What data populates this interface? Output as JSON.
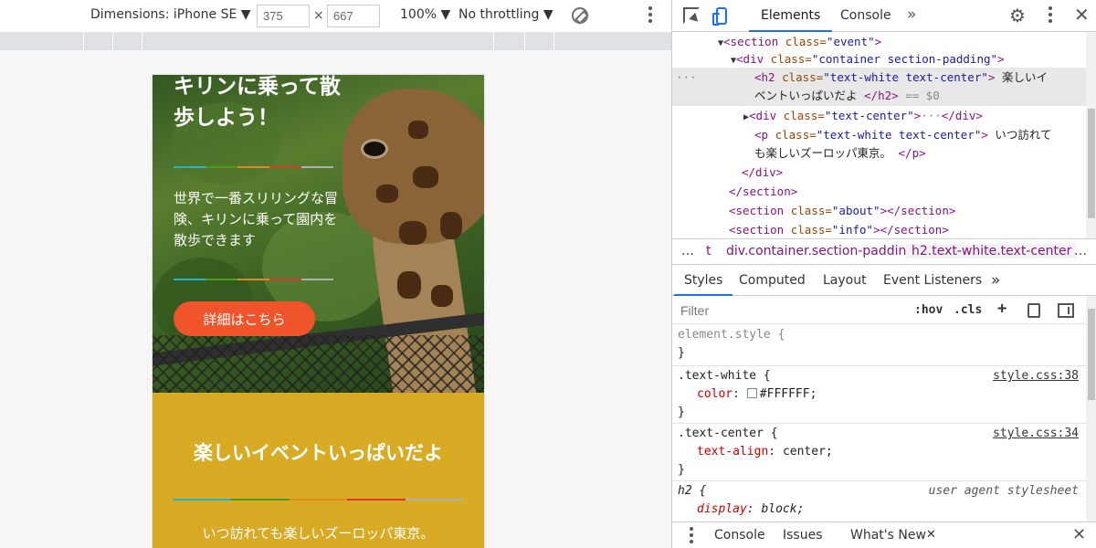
{
  "device_toolbar": {
    "dimensions": "Dimensions: iPhone SE",
    "width": "375",
    "height": "667",
    "times": "×",
    "zoom": "100%",
    "throttling": "No throttling"
  },
  "page": {
    "hero_title": "キリンに乗って散歩しよう！",
    "hero_text": "世界で一番スリリングな冒険、キリンに乗って園内を散歩できます",
    "cta_label": "詳細はこちら",
    "event_title": "楽しいイベントいっぱいだよ",
    "event_text": "いつ訪れても楽しいズーロッパ東京。",
    "stripe_colors": [
      "#1fb6c9",
      "#4e9a1e",
      "#e0891f",
      "#d9392b",
      "#b0b0b0"
    ],
    "button_color": "#f0542b",
    "event_bg": "#d9ab25"
  },
  "devtools": {
    "tabs": [
      "Elements",
      "Console"
    ],
    "active_tab": "Elements",
    "more": "»",
    "dom": {
      "l1_tag": "<section",
      "l1_attr": " class=",
      "l1_val": "\"event\"",
      "l1_end": ">",
      "l2_tag": "<div",
      "l2_attr": " class=",
      "l2_val": "\"container section-padding\"",
      "l2_end": ">",
      "sel_tag": "<h2",
      "sel_attr": " class=",
      "sel_val": "\"text-white text-center\"",
      "sel_end": ">",
      "sel_text1": " 楽しいイ",
      "sel_text2": "ベントいっぱいだよ ",
      "sel_close": "</h2>",
      "sel_eq": " == $0",
      "ellipsis": "···",
      "l4_tag": "<div",
      "l4_attr": " class=",
      "l4_val": "\"text-center\"",
      "l4_end": ">",
      "l4_dots": "···",
      "l4_close": "</div>",
      "l5_tag": "<p",
      "l5_attr": " class=",
      "l5_val": "\"text-white text-center\"",
      "l5_end": ">",
      "l5_text1": " いつ訪れて",
      "l5_text2": "も楽しいズーロッパ東京。 ",
      "l5_close": "</p>",
      "l6": "</div>",
      "l7": "</section>",
      "l8_tag": "<section",
      "l8_attr": " class=",
      "l8_val": "\"about\"",
      "l8_end": "></section>",
      "l9_tag": "<section",
      "l9_attr": " class=",
      "l9_val": "\"info\"",
      "l9_end": "></section>"
    },
    "breadcrumb": [
      "…",
      "t",
      "div.container.section-padding",
      "h2.text-white.text-center",
      "…"
    ],
    "style_tabs": [
      "Styles",
      "Computed",
      "Layout",
      "Event Listeners"
    ],
    "styles_more": "»",
    "filter_placeholder": "Filter",
    "hov": ":hov",
    "cls": ".cls",
    "plus": "+",
    "rules": {
      "r1_sel": "element.style {",
      "r1_close": "}",
      "r2_sel": ".text-white {",
      "r2_src": "style.css:38",
      "r2_prop": "color",
      "r2_val": "#FFFFFF;",
      "r2_close": "}",
      "r3_sel": ".text-center {",
      "r3_src": "style.css:34",
      "r3_prop": "text-align",
      "r3_val": "center;",
      "r3_close": "}",
      "r4_sel": "h2 {",
      "r4_src": "user agent stylesheet",
      "r4_prop": "display",
      "r4_val": "block;"
    },
    "drawer_tabs": [
      "Console",
      "Issues",
      "What's New"
    ]
  }
}
